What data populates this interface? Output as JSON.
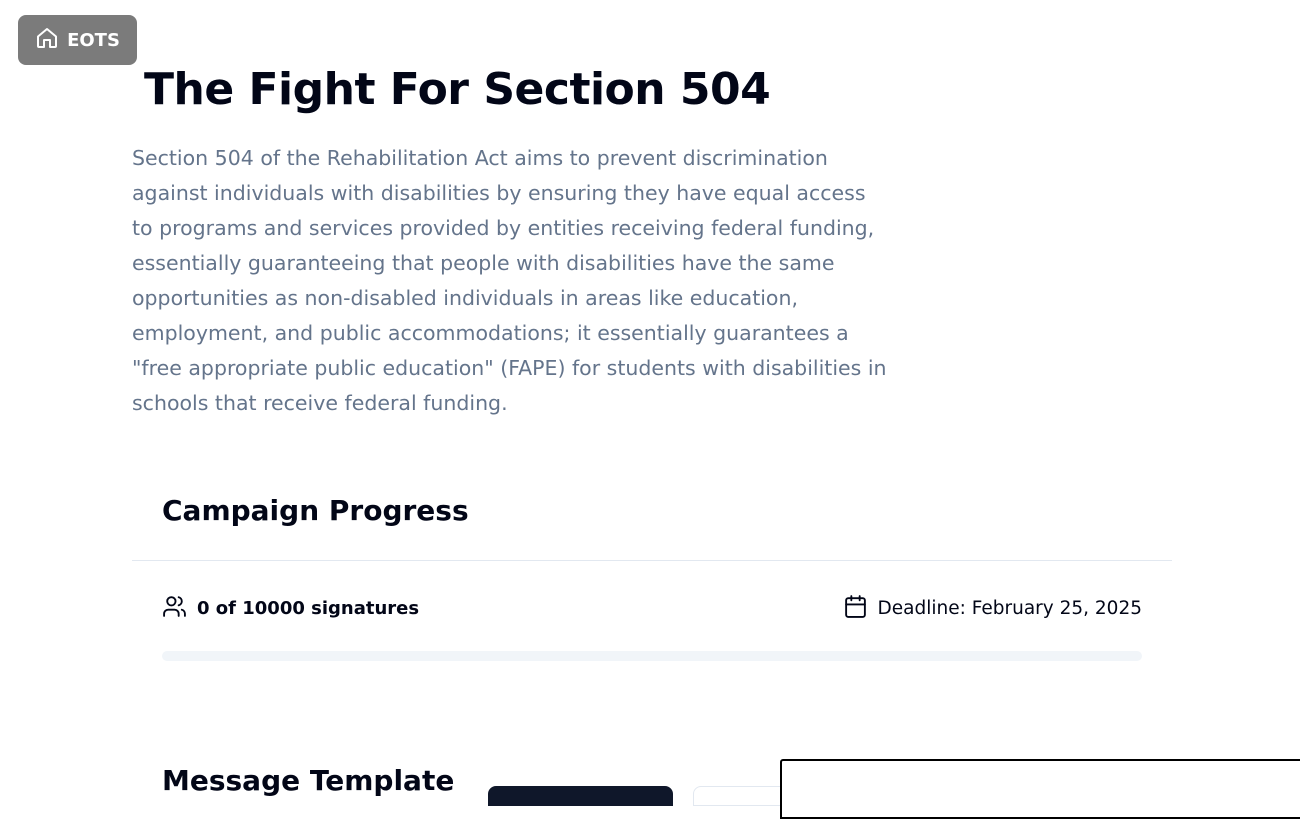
{
  "home_button": {
    "label": "EOTS",
    "icon": "home-icon"
  },
  "page": {
    "title": "The Fight For Section 504",
    "description": "Section 504 of the Rehabilitation Act aims to prevent discrimination against individuals with disabilities by ensuring they have equal access to programs and services provided by entities receiving federal funding, essentially guaranteeing that people with disabilities have the same opportunities as non-disabled individuals in areas like education, employment, and public accommodations; it essentially guarantees a \"free appropriate public education\" (FAPE) for students with disabilities in schools that receive federal funding."
  },
  "campaign": {
    "title": "Campaign Progress",
    "signatures_text": "0 of 10000 signatures",
    "signatures_icon": "users-icon",
    "deadline_text": "Deadline: February 25, 2025",
    "deadline_icon": "calendar-icon",
    "progress_fraction": 0
  },
  "message_template": {
    "title": "Message Template"
  },
  "colors": {
    "home_button_bg": "#7b7b7b",
    "description_text": "#64748b",
    "progress_track": "#f1f5f9",
    "tab_dark": "#0f172a"
  }
}
